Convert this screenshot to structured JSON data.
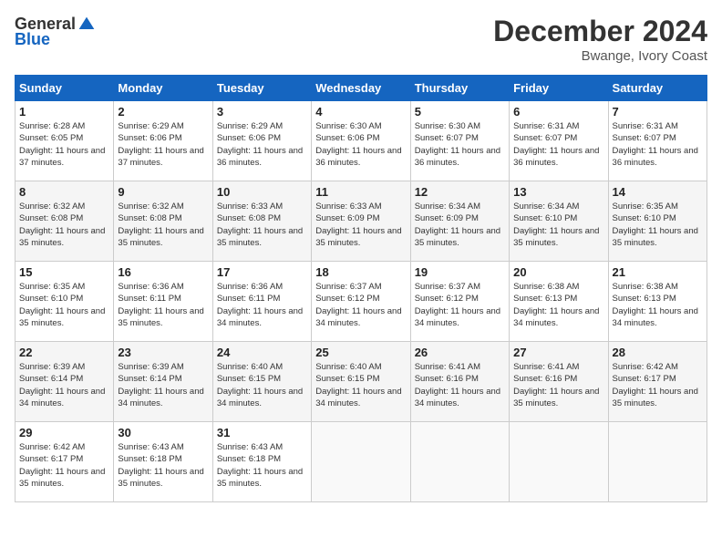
{
  "logo": {
    "general": "General",
    "blue": "Blue"
  },
  "header": {
    "month": "December 2024",
    "location": "Bwange, Ivory Coast"
  },
  "weekdays": [
    "Sunday",
    "Monday",
    "Tuesday",
    "Wednesday",
    "Thursday",
    "Friday",
    "Saturday"
  ],
  "weeks": [
    [
      {
        "day": "1",
        "sunrise": "6:28 AM",
        "sunset": "6:05 PM",
        "daylight": "11 hours and 37 minutes."
      },
      {
        "day": "2",
        "sunrise": "6:29 AM",
        "sunset": "6:06 PM",
        "daylight": "11 hours and 37 minutes."
      },
      {
        "day": "3",
        "sunrise": "6:29 AM",
        "sunset": "6:06 PM",
        "daylight": "11 hours and 36 minutes."
      },
      {
        "day": "4",
        "sunrise": "6:30 AM",
        "sunset": "6:06 PM",
        "daylight": "11 hours and 36 minutes."
      },
      {
        "day": "5",
        "sunrise": "6:30 AM",
        "sunset": "6:07 PM",
        "daylight": "11 hours and 36 minutes."
      },
      {
        "day": "6",
        "sunrise": "6:31 AM",
        "sunset": "6:07 PM",
        "daylight": "11 hours and 36 minutes."
      },
      {
        "day": "7",
        "sunrise": "6:31 AM",
        "sunset": "6:07 PM",
        "daylight": "11 hours and 36 minutes."
      }
    ],
    [
      {
        "day": "8",
        "sunrise": "6:32 AM",
        "sunset": "6:08 PM",
        "daylight": "11 hours and 35 minutes."
      },
      {
        "day": "9",
        "sunrise": "6:32 AM",
        "sunset": "6:08 PM",
        "daylight": "11 hours and 35 minutes."
      },
      {
        "day": "10",
        "sunrise": "6:33 AM",
        "sunset": "6:08 PM",
        "daylight": "11 hours and 35 minutes."
      },
      {
        "day": "11",
        "sunrise": "6:33 AM",
        "sunset": "6:09 PM",
        "daylight": "11 hours and 35 minutes."
      },
      {
        "day": "12",
        "sunrise": "6:34 AM",
        "sunset": "6:09 PM",
        "daylight": "11 hours and 35 minutes."
      },
      {
        "day": "13",
        "sunrise": "6:34 AM",
        "sunset": "6:10 PM",
        "daylight": "11 hours and 35 minutes."
      },
      {
        "day": "14",
        "sunrise": "6:35 AM",
        "sunset": "6:10 PM",
        "daylight": "11 hours and 35 minutes."
      }
    ],
    [
      {
        "day": "15",
        "sunrise": "6:35 AM",
        "sunset": "6:10 PM",
        "daylight": "11 hours and 35 minutes."
      },
      {
        "day": "16",
        "sunrise": "6:36 AM",
        "sunset": "6:11 PM",
        "daylight": "11 hours and 35 minutes."
      },
      {
        "day": "17",
        "sunrise": "6:36 AM",
        "sunset": "6:11 PM",
        "daylight": "11 hours and 34 minutes."
      },
      {
        "day": "18",
        "sunrise": "6:37 AM",
        "sunset": "6:12 PM",
        "daylight": "11 hours and 34 minutes."
      },
      {
        "day": "19",
        "sunrise": "6:37 AM",
        "sunset": "6:12 PM",
        "daylight": "11 hours and 34 minutes."
      },
      {
        "day": "20",
        "sunrise": "6:38 AM",
        "sunset": "6:13 PM",
        "daylight": "11 hours and 34 minutes."
      },
      {
        "day": "21",
        "sunrise": "6:38 AM",
        "sunset": "6:13 PM",
        "daylight": "11 hours and 34 minutes."
      }
    ],
    [
      {
        "day": "22",
        "sunrise": "6:39 AM",
        "sunset": "6:14 PM",
        "daylight": "11 hours and 34 minutes."
      },
      {
        "day": "23",
        "sunrise": "6:39 AM",
        "sunset": "6:14 PM",
        "daylight": "11 hours and 34 minutes."
      },
      {
        "day": "24",
        "sunrise": "6:40 AM",
        "sunset": "6:15 PM",
        "daylight": "11 hours and 34 minutes."
      },
      {
        "day": "25",
        "sunrise": "6:40 AM",
        "sunset": "6:15 PM",
        "daylight": "11 hours and 34 minutes."
      },
      {
        "day": "26",
        "sunrise": "6:41 AM",
        "sunset": "6:16 PM",
        "daylight": "11 hours and 34 minutes."
      },
      {
        "day": "27",
        "sunrise": "6:41 AM",
        "sunset": "6:16 PM",
        "daylight": "11 hours and 35 minutes."
      },
      {
        "day": "28",
        "sunrise": "6:42 AM",
        "sunset": "6:17 PM",
        "daylight": "11 hours and 35 minutes."
      }
    ],
    [
      {
        "day": "29",
        "sunrise": "6:42 AM",
        "sunset": "6:17 PM",
        "daylight": "11 hours and 35 minutes."
      },
      {
        "day": "30",
        "sunrise": "6:43 AM",
        "sunset": "6:18 PM",
        "daylight": "11 hours and 35 minutes."
      },
      {
        "day": "31",
        "sunrise": "6:43 AM",
        "sunset": "6:18 PM",
        "daylight": "11 hours and 35 minutes."
      },
      null,
      null,
      null,
      null
    ]
  ]
}
